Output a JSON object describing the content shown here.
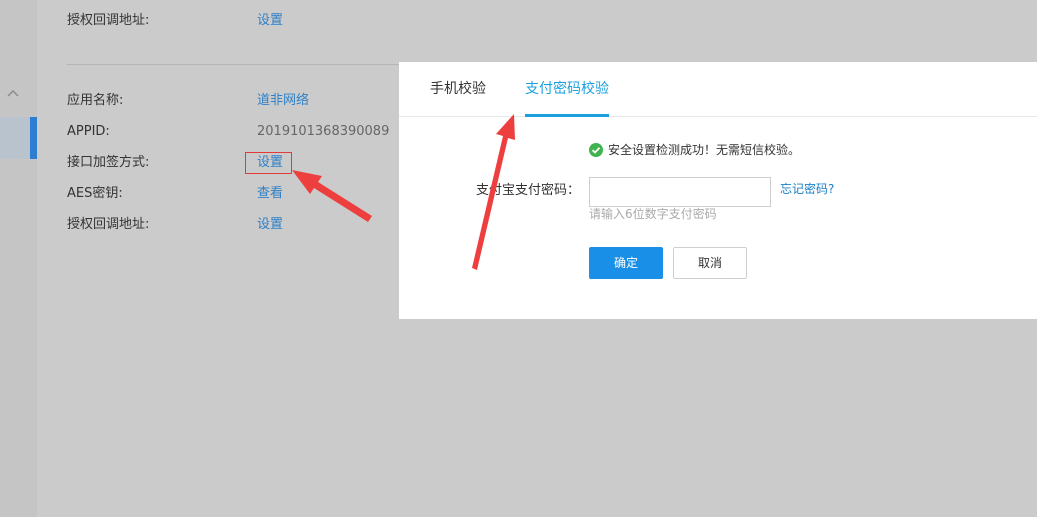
{
  "left_rail": {
    "collapse_icon": "chevron-up-icon"
  },
  "top_section": {
    "callback_label": "授权回调地址:",
    "callback_link": "设置"
  },
  "app_info": {
    "rows": [
      {
        "label": "应用名称:",
        "value": "道非网络",
        "kind": "link"
      },
      {
        "label": "APPID:",
        "value": "2019101368390089",
        "kind": "plain"
      },
      {
        "label": "接口加签方式:",
        "value": "设置",
        "kind": "link"
      },
      {
        "label": "AES密钥:",
        "value": "查看",
        "kind": "link"
      },
      {
        "label": "授权回调地址:",
        "value": "设置",
        "kind": "link"
      }
    ]
  },
  "dialog": {
    "tabs": [
      {
        "label": "手机校验",
        "active": false
      },
      {
        "label": "支付密码校验",
        "active": true
      }
    ],
    "success_icon": "check-circle-icon",
    "success_message": "安全设置检测成功！无需短信校验。",
    "password_label": "支付宝支付密码：",
    "password_value": "",
    "forgot_link": "忘记密码?",
    "hint": "请输入6位数字支付密码",
    "confirm_button": "确定",
    "cancel_button": "取消"
  },
  "colors": {
    "accent": "#1a9fe0",
    "primary_button": "#1a8fe8",
    "link": "#2f80c7",
    "annotation_red": "#e03a3a",
    "success_green": "#3fb34f"
  }
}
